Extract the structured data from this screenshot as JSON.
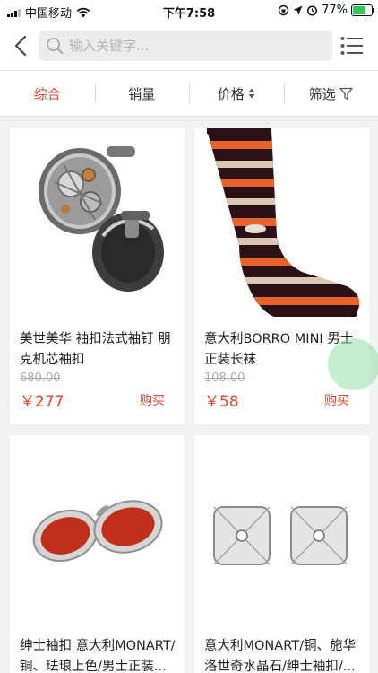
{
  "status_bar": {
    "carrier": "中国移动",
    "time": "下午7:58",
    "battery_percent": "77%",
    "battery_level": 0.77
  },
  "search": {
    "placeholder": "输入关键字..."
  },
  "sort_tabs": [
    {
      "label": "综合",
      "active": true
    },
    {
      "label": "销量"
    },
    {
      "label": "价格"
    },
    {
      "label": "筛选"
    }
  ],
  "products": [
    {
      "title": "美世美华 袖扣法式袖钉 朋克机芯袖扣",
      "old_price": "680.00",
      "price": "￥277",
      "buy": "购买"
    },
    {
      "title": "意大利BORRO MINI 男士正装长袜",
      "old_price": "108.00",
      "price": "￥58",
      "buy": "购买"
    },
    {
      "title": "绅士袖扣 意大利MONART/铜、珐琅上色/男士正装...",
      "old_price": "",
      "price": "",
      "buy": ""
    },
    {
      "title": "意大利MONART/铜、施华洛世奇水晶石/绅士袖扣/...",
      "old_price": "",
      "price": "",
      "buy": ""
    }
  ],
  "colors": {
    "accent": "#e8452c",
    "background": "#f2f2f2"
  }
}
